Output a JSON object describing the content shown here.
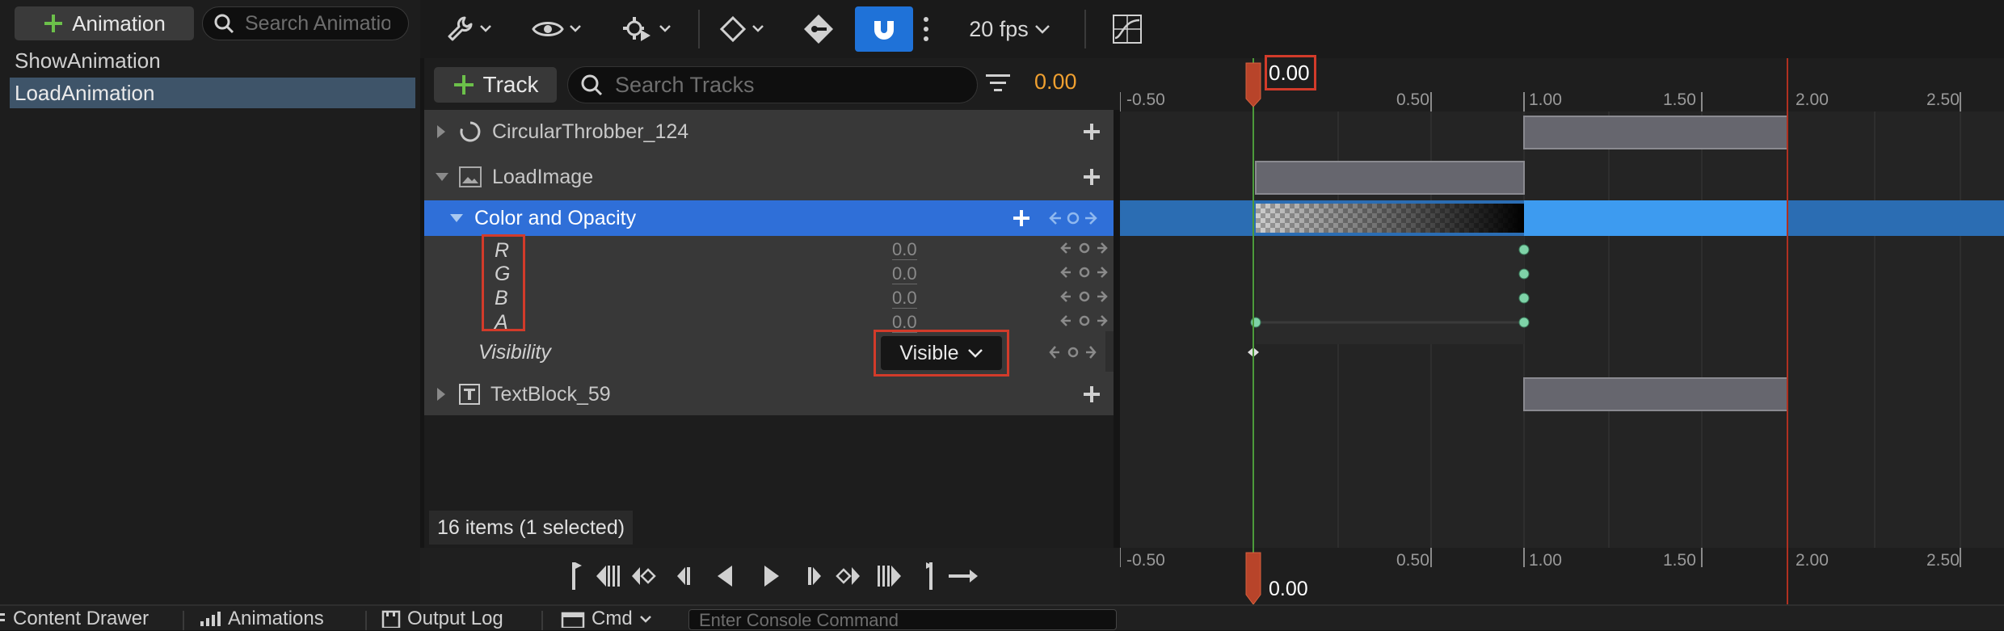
{
  "animations": {
    "add_label": "Animation",
    "search_placeholder": "Search Animations",
    "items": [
      {
        "label": "ShowAnimation",
        "selected": false
      },
      {
        "label": "LoadAnimation",
        "selected": true
      }
    ]
  },
  "toolbar": {
    "fps_label": "20 fps",
    "snap_enabled": true
  },
  "tracks_header": {
    "add_label": "Track",
    "search_placeholder": "Search Tracks",
    "current_time": "0.00"
  },
  "tracks": {
    "circular_throbber": "CircularThrobber_124",
    "load_image": "LoadImage",
    "color_opacity": "Color and Opacity",
    "channels": [
      {
        "name": "R",
        "value": "0.0"
      },
      {
        "name": "G",
        "value": "0.0"
      },
      {
        "name": "B",
        "value": "0.0"
      },
      {
        "name": "A",
        "value": "0.0"
      }
    ],
    "visibility_label": "Visibility",
    "visibility_value": "Visible",
    "text_block": "TextBlock_59"
  },
  "status": {
    "items_count": "16 items (1 selected)"
  },
  "timeline": {
    "playhead_time": "0.00",
    "ruler_labels": [
      "-0.50",
      "0.50",
      "1.00",
      "1.50",
      "2.00",
      "2.50"
    ]
  },
  "statusbar": {
    "content_drawer": "Content Drawer",
    "animations": "Animations",
    "output_log": "Output Log",
    "cmd": "Cmd",
    "console_placeholder": "Enter Console Command"
  },
  "colors": {
    "selection_blue": "#2f6fd8",
    "accent_orange": "#f0a030",
    "add_green": "#6cc04a",
    "key_green": "#7fd3a8",
    "highlight_red": "#d23b2a"
  }
}
